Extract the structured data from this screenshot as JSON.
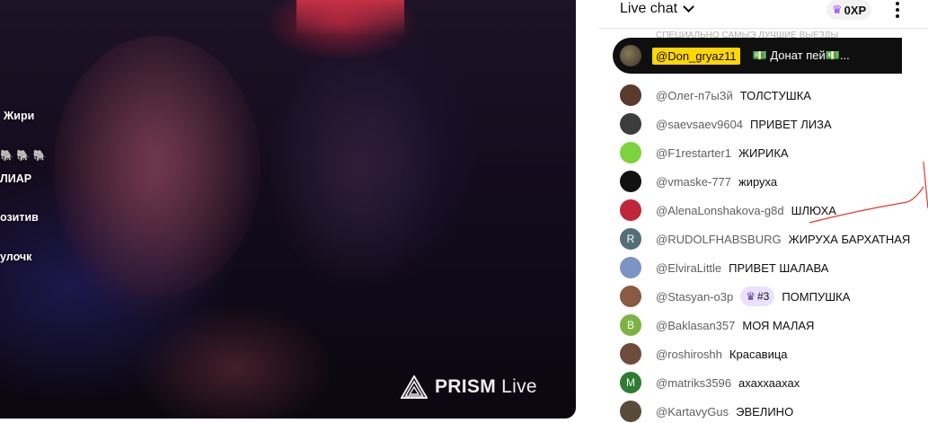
{
  "video": {
    "overlay_messages": [
      "Жири",
      "🐘 🐘 🐘",
      "ЛИАР",
      "озитив",
      "улочк"
    ],
    "watermark": {
      "brand": "PRISM",
      "suffix": "Live"
    }
  },
  "chat": {
    "title": "Live chat",
    "xp_label": "0XP",
    "more_icon": "more-vert-icon",
    "pinned_background_text": "СПЕЦИАЛЬНО САМЫЭ ЛУЧШИЕ ВЫЕЗДЫ",
    "pinned": {
      "author": "@Don_gryaz11",
      "message": "💵 Донат пей💵..."
    },
    "messages": [
      {
        "author": "@Олег-п7ыЗй",
        "text": "ТОЛСТУШКА",
        "avatar_color": "#5b3a2e",
        "avatar_letter": ""
      },
      {
        "author": "@saevsaev9604",
        "text": "ПРИВЕТ ЛИЗА",
        "avatar_color": "#3d3d3d",
        "avatar_letter": ""
      },
      {
        "author": "@F1restarter1",
        "text": "ЖИРИКА",
        "avatar_color": "#7cd33c",
        "avatar_letter": ""
      },
      {
        "author": "@vmaske-777",
        "text": "жируха",
        "avatar_color": "#111111",
        "avatar_letter": ""
      },
      {
        "author": "@AlenaLonshakova-g8d",
        "text": "ШЛЮХА",
        "avatar_color": "#c0263b",
        "avatar_letter": ""
      },
      {
        "author": "@RUDOLFHABSBURG",
        "text": "ЖИРУХА БАРХАТНАЯ",
        "avatar_color": "#546e7a",
        "avatar_letter": "R"
      },
      {
        "author": "@ElviraLittle",
        "text": "ПРИВЕТ ШАЛАВА",
        "avatar_color": "#7d93c4",
        "avatar_letter": ""
      },
      {
        "author": "@Stasyan-o3p",
        "text": "ПОМПУШКА",
        "avatar_color": "#8a5a44",
        "avatar_letter": "",
        "badge": "#3"
      },
      {
        "author": "@Baklasan357",
        "text": "МОЯ МАЛАЯ",
        "avatar_color": "#7cb342",
        "avatar_letter": "B"
      },
      {
        "author": "@roshiroshh",
        "text": "Красавица",
        "avatar_color": "#6d4c3d",
        "avatar_letter": ""
      },
      {
        "author": "@matriks3596",
        "text": "ахаххаахах",
        "avatar_color": "#2e7d32",
        "avatar_letter": "M"
      },
      {
        "author": "@KartavyGus",
        "text": "ЭВЕЛИНО",
        "avatar_color": "#5a4a3a",
        "avatar_letter": ""
      }
    ]
  },
  "colors": {
    "pinned_author_bg": "#ffd600",
    "xp_crown": "#9146ff",
    "annotation_stroke": "#e53935"
  }
}
